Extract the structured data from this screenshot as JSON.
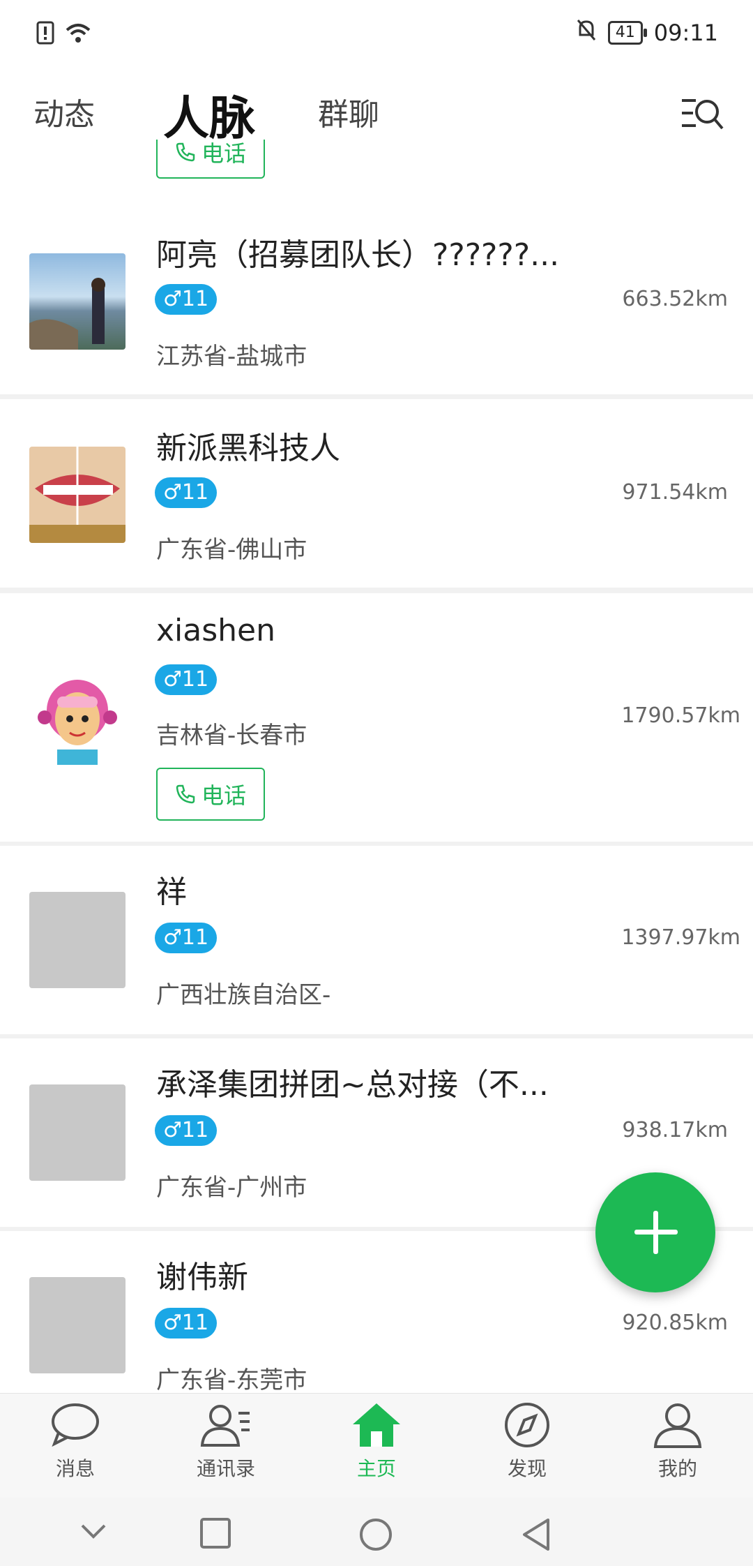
{
  "status_bar": {
    "time": "09:11",
    "battery": "41"
  },
  "top_nav": {
    "tabs": [
      "动态",
      "人脉",
      "群聊"
    ],
    "active_tab": "人脉"
  },
  "partial_row": {
    "phone_label": "电话"
  },
  "contacts": [
    {
      "name": "阿亮（招募团队长）??????...",
      "gender_age": "♂11",
      "location": "江苏省-盐城市",
      "distance": "663.52km"
    },
    {
      "name": "新派黑科技人",
      "gender_age": "♂11",
      "location": "广东省-佛山市",
      "distance": "971.54km"
    },
    {
      "name": "xiashen",
      "gender_age": "♂11",
      "location": "吉林省-长春市",
      "distance": "1790.57km",
      "phone_label": "电话"
    },
    {
      "name": "祥",
      "gender_age": "♂11",
      "location": "广西壮族自治区-",
      "distance": "1397.97km"
    },
    {
      "name": "承泽集团拼团~总对接（不...",
      "gender_age": "♂11",
      "location": "广东省-广州市",
      "distance": "938.17km"
    },
    {
      "name": "谢伟新",
      "gender_age": "♂11",
      "location": "广东省-东莞市",
      "distance": "920.85km"
    }
  ],
  "bottom_nav": {
    "items": [
      "消息",
      "通讯录",
      "主页",
      "发现",
      "我的"
    ],
    "active": "主页"
  },
  "colors": {
    "accent": "#1db954",
    "badge": "#1aa7e6",
    "phone_border": "#21b45a"
  }
}
